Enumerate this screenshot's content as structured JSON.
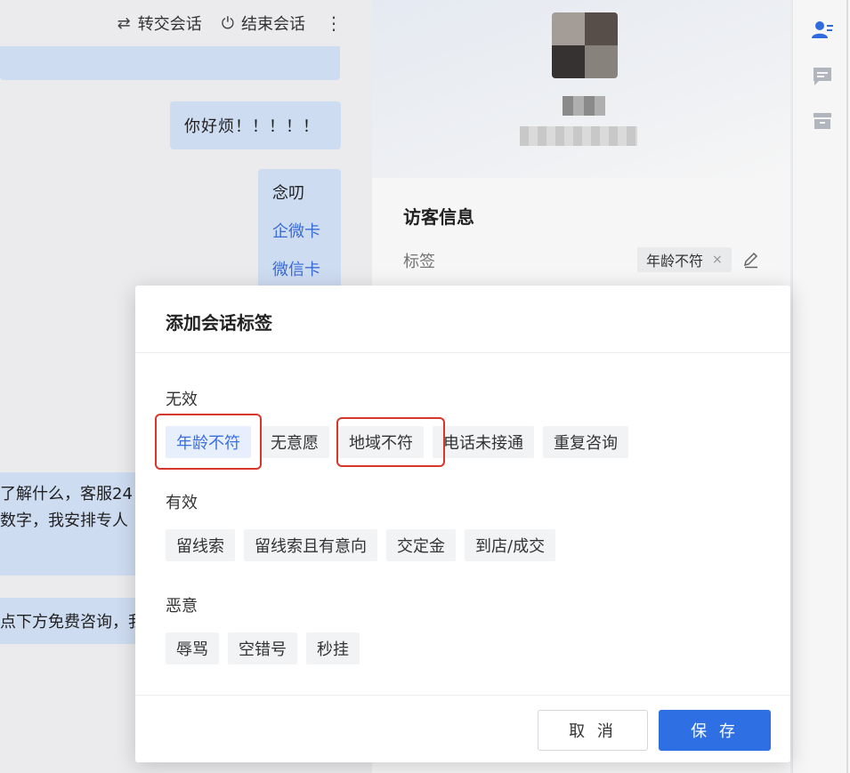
{
  "chat": {
    "header": {
      "transfer_label": "转交会话",
      "end_label": "结束会话",
      "more_glyph": "⋮"
    },
    "messages": {
      "hello": "你好烦！！！！！",
      "menu": [
        "念叨",
        "企微卡",
        "微信卡"
      ],
      "left1_line1": "了解什么，客服24",
      "left1_line2": "数字，我安排专人",
      "left2": "点下方免费咨询，我"
    }
  },
  "profile": {
    "section_title": "访客信息",
    "tag_label": "标签",
    "current_tag": "年龄不符",
    "current_tag_close": "×"
  },
  "modal": {
    "title": "添加会话标签",
    "groups": [
      {
        "label": "无效",
        "tags": [
          "年龄不符",
          "无意愿",
          "地域不符",
          "电话未接通",
          "重复咨询"
        ]
      },
      {
        "label": "有效",
        "tags": [
          "留线索",
          "留线索且有意向",
          "交定金",
          "到店/成交"
        ]
      },
      {
        "label": "恶意",
        "tags": [
          "辱骂",
          "空错号",
          "秒挂"
        ]
      }
    ],
    "selected_tag": "年龄不符",
    "cancel_label": "取 消",
    "save_label": "保 存"
  },
  "colors": {
    "accent": "#2f6fe4",
    "link": "#3a6fe0",
    "highlight": "#d9362b",
    "bubble": "#d6e4fb"
  }
}
